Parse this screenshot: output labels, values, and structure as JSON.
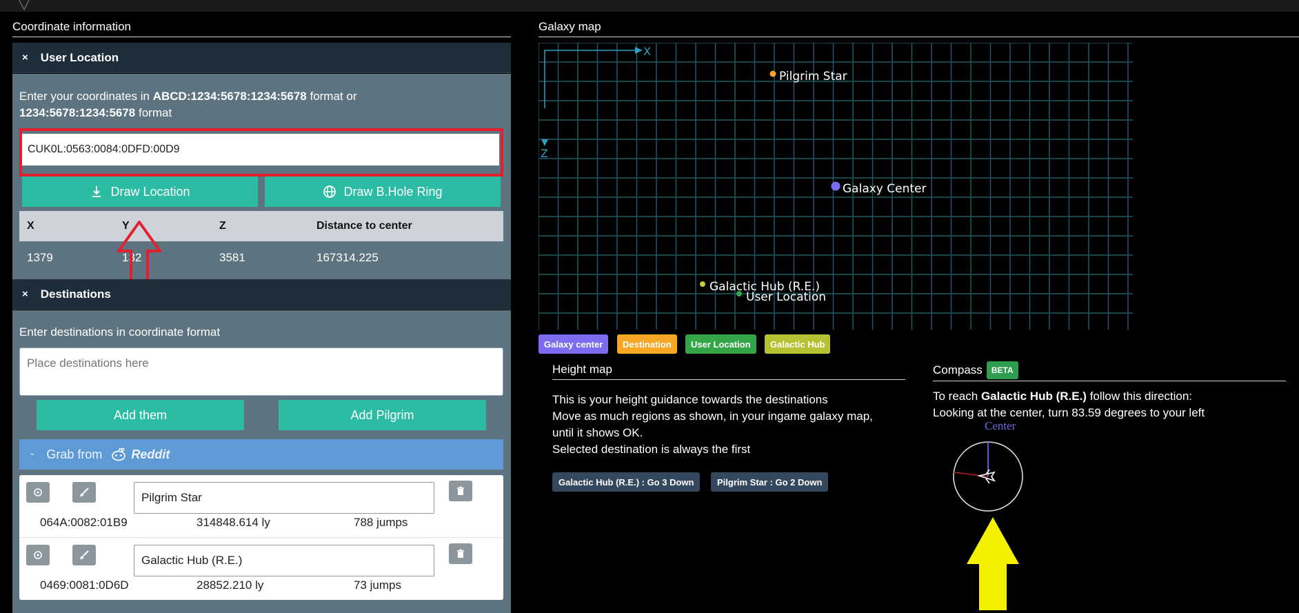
{
  "coordinate_section": {
    "title": "Coordinate information"
  },
  "user_location": {
    "header": "User Location",
    "close_glyph": "×",
    "intro_1": "Enter your coordinates in ",
    "intro_fmt1": "ABCD:1234:5678:1234:5678",
    "intro_2": " format or",
    "intro_fmt2": "1234:5678:1234:5678",
    "intro_3": " format",
    "coord_value": "CUK0L:0563:0084:0DFD:00D9",
    "draw_location_label": "Draw Location",
    "draw_ring_label": "Draw B.Hole Ring",
    "table": {
      "headers": [
        "X",
        "Y",
        "Z",
        "Distance to center"
      ],
      "row": [
        "1379",
        "132",
        "3581",
        "167314.225"
      ]
    }
  },
  "destinations": {
    "header": "Destinations",
    "close_glyph": "×",
    "label": "Enter destinations in coordinate format",
    "placeholder": "Place destinations here",
    "add_them_label": "Add them",
    "add_pilgrim_label": "Add Pilgrim",
    "grab_minus": "-",
    "grab_label": "Grab from",
    "grab_source": "Reddit",
    "items": [
      {
        "name": "Pilgrim Star",
        "coord": "064A:0082:01B9",
        "distance": "314848.614 ly",
        "jumps": "788 jumps"
      },
      {
        "name": "Galactic Hub (R.E.)",
        "coord": "0469:0081:0D6D",
        "distance": "28852.210 ly",
        "jumps": "73 jumps"
      }
    ]
  },
  "galaxy_map": {
    "title": "Galaxy map",
    "axis_x": "X",
    "axis_z": "Z",
    "points": [
      {
        "label": "Pilgrim Star",
        "color": "#f5a623"
      },
      {
        "label": "Galaxy Center",
        "color": "#7b6cf0"
      },
      {
        "label": "Galactic Hub (R.E.)",
        "color": "#c5cc3a"
      },
      {
        "label": "User Location",
        "color": "#33a852"
      }
    ],
    "legend": [
      {
        "label": "Galaxy center",
        "color": "#7b6cf0"
      },
      {
        "label": "Destination",
        "color": "#f5a623"
      },
      {
        "label": "User Location",
        "color": "#35a54a"
      },
      {
        "label": "Galactic Hub",
        "color": "#b8c132"
      }
    ]
  },
  "height_map": {
    "title": "Height map",
    "lines": [
      "This is your height guidance towards the destinations",
      "Move as much regions as shown, in your ingame galaxy map,",
      "until it shows OK.",
      "Selected destination is always the first"
    ],
    "badges": [
      "Galactic Hub (R.E.) : Go 3 Down",
      "Pilgrim Star : Go 2 Down"
    ]
  },
  "compass": {
    "title": "Compass",
    "beta": "BETA",
    "reach_1": "To reach ",
    "reach_target": "Galactic Hub (R.E.)",
    "reach_2": " follow this direction:",
    "instruction": "Looking at the center, turn 83.59 degrees to your left",
    "center_label": "Center"
  }
}
